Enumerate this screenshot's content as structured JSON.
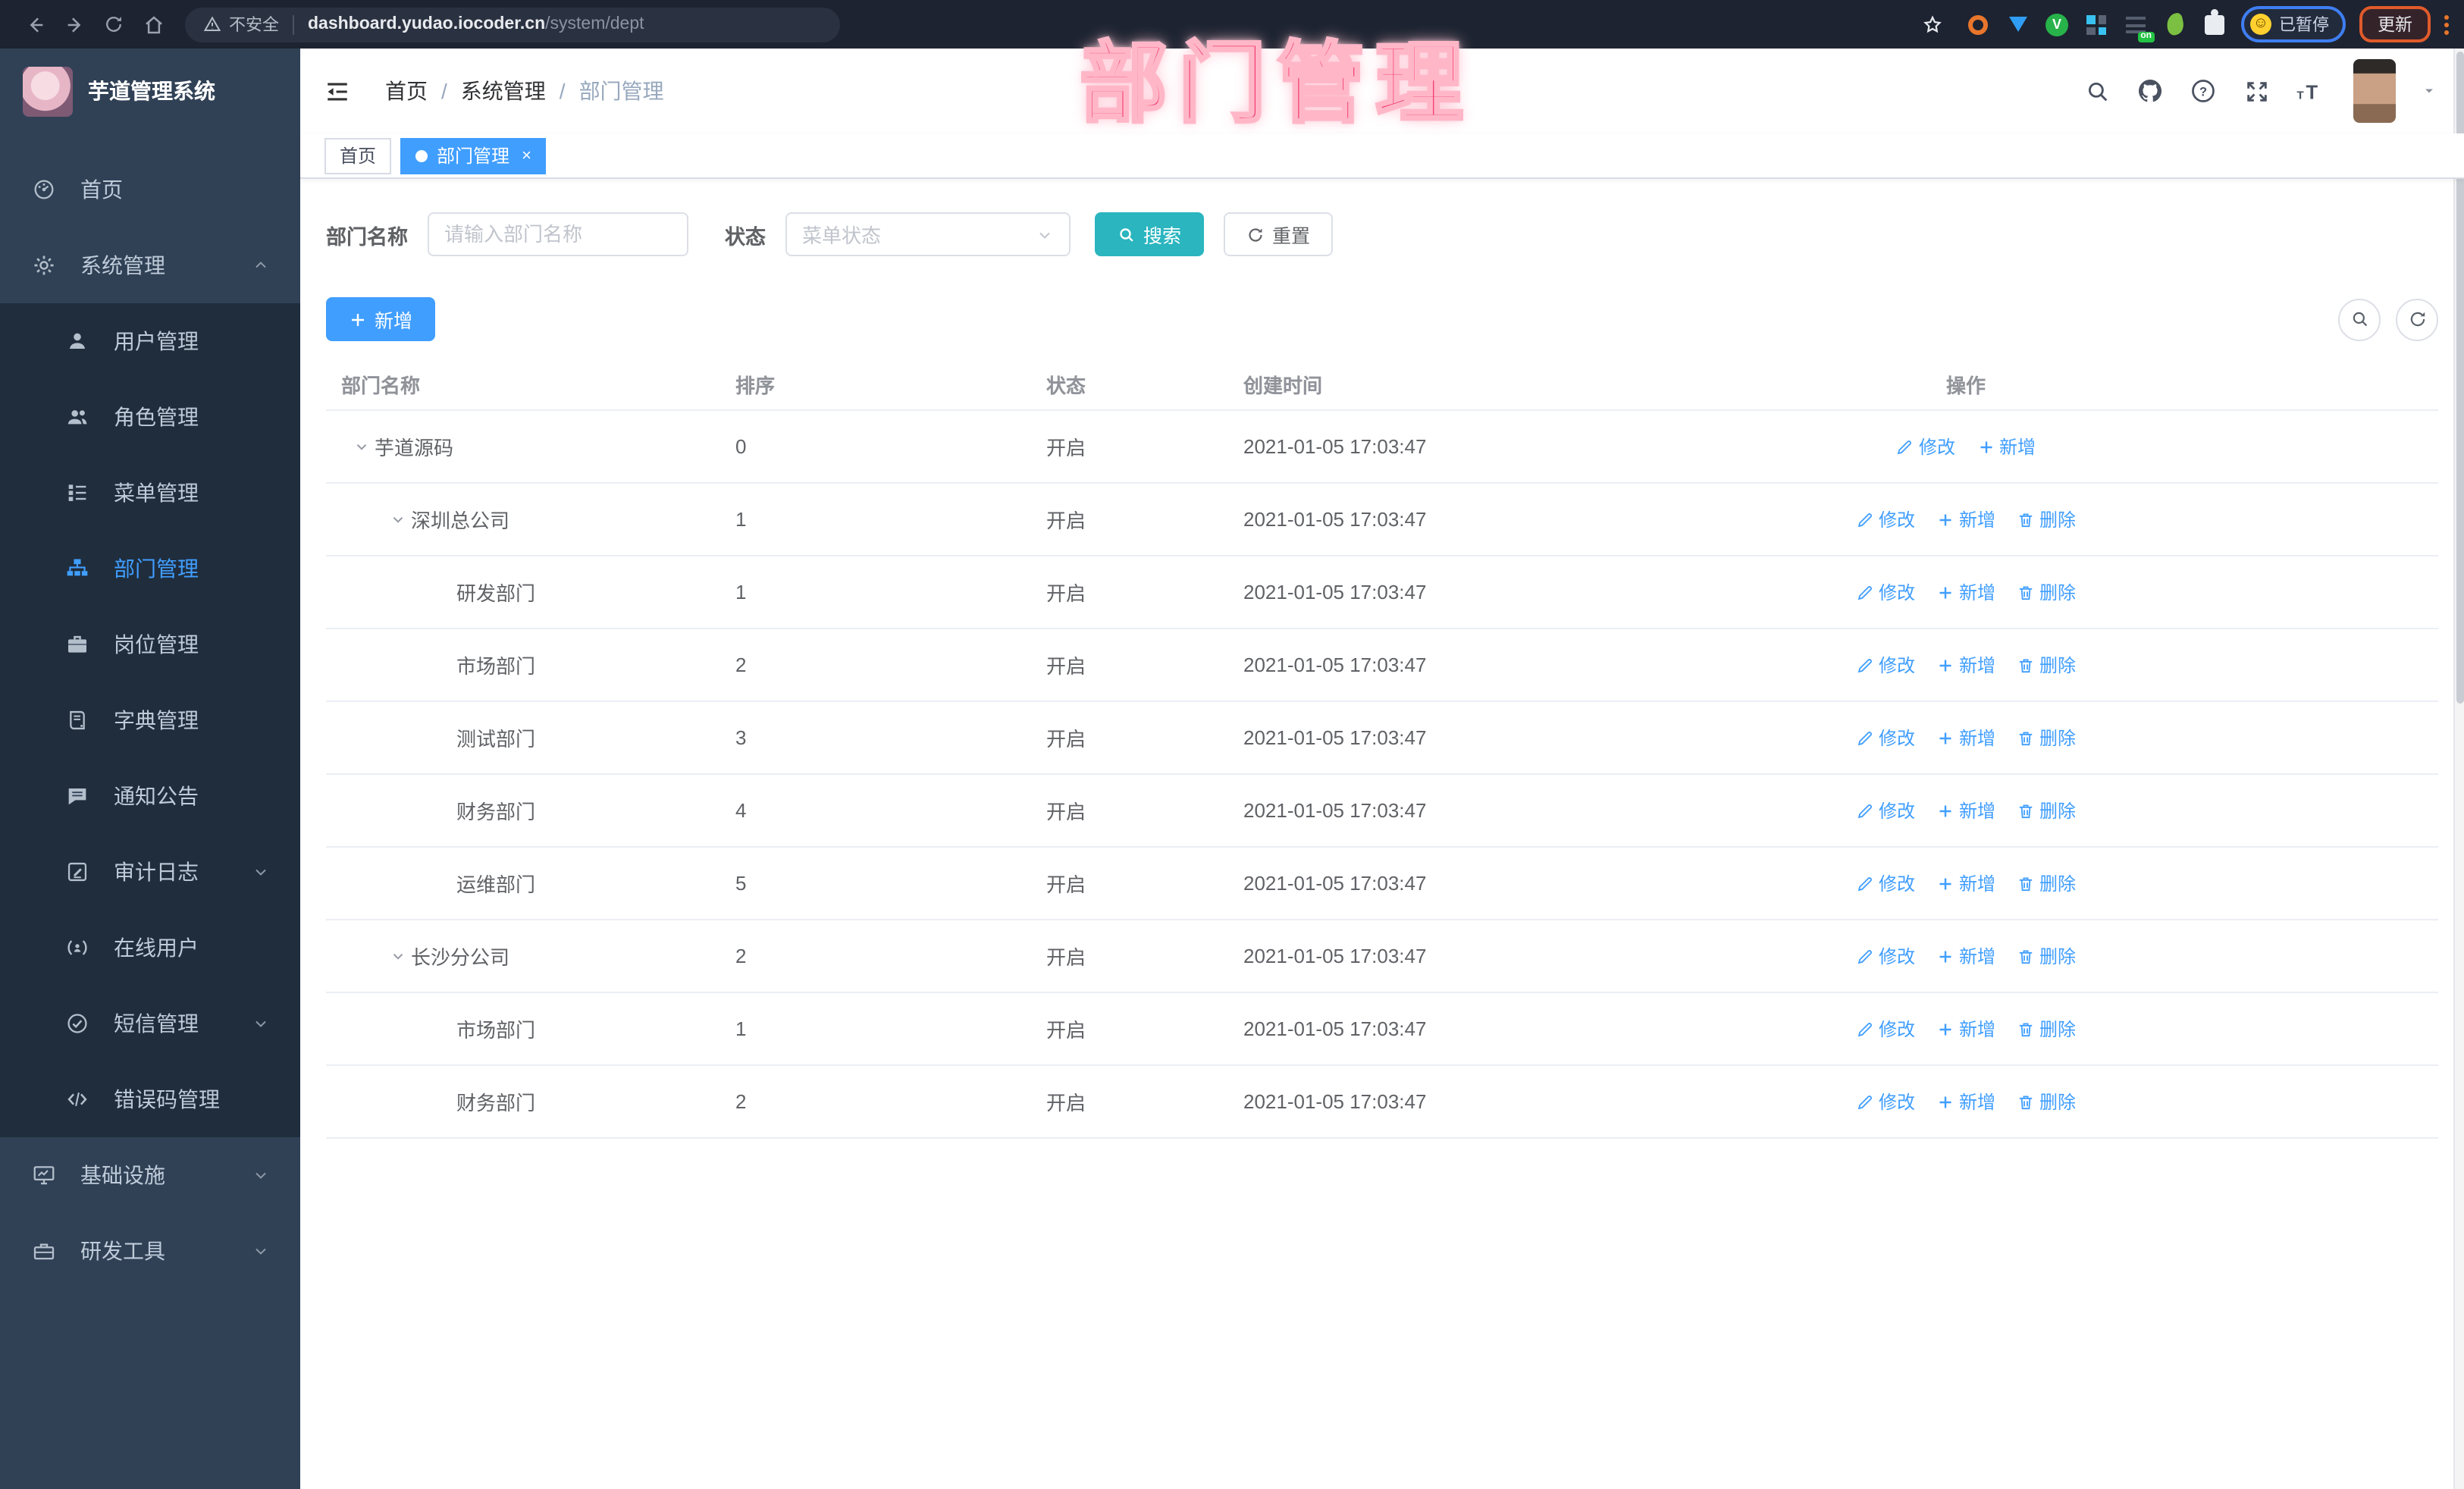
{
  "browser": {
    "security_label": "不安全",
    "url_host": "dashboard.yudao.iocoder.cn",
    "url_path": "/system/dept",
    "extension_badge": "on",
    "paused_badge": "已暂停",
    "update_button": "更新",
    "extensions": [
      "ext-orange-ring-icon",
      "ext-blue-drop-icon",
      "ext-green-check-icon",
      "ext-blue-grid-icon",
      "ext-list-on-icon",
      "ext-green-leaf-icon",
      "ext-puzzle-icon"
    ]
  },
  "overlay": {
    "title": "部门管理"
  },
  "sidebar": {
    "app_title": "芋道管理系统",
    "items": [
      {
        "label": "首页",
        "icon": "dashboard-icon",
        "sub": false,
        "arrow": null,
        "active": false
      },
      {
        "label": "系统管理",
        "icon": "gear-icon",
        "sub": false,
        "arrow": "up",
        "active": false
      },
      {
        "label": "用户管理",
        "icon": "user-icon",
        "sub": true,
        "arrow": null,
        "active": false
      },
      {
        "label": "角色管理",
        "icon": "users-icon",
        "sub": true,
        "arrow": null,
        "active": false
      },
      {
        "label": "菜单管理",
        "icon": "menu-tree-icon",
        "sub": true,
        "arrow": null,
        "active": false
      },
      {
        "label": "部门管理",
        "icon": "org-tree-icon",
        "sub": true,
        "arrow": null,
        "active": true
      },
      {
        "label": "岗位管理",
        "icon": "briefcase-icon",
        "sub": true,
        "arrow": null,
        "active": false
      },
      {
        "label": "字典管理",
        "icon": "dictionary-icon",
        "sub": true,
        "arrow": null,
        "active": false
      },
      {
        "label": "通知公告",
        "icon": "announcement-icon",
        "sub": true,
        "arrow": null,
        "active": false
      },
      {
        "label": "审计日志",
        "icon": "audit-log-icon",
        "sub": true,
        "arrow": "down",
        "active": false
      },
      {
        "label": "在线用户",
        "icon": "online-user-icon",
        "sub": true,
        "arrow": null,
        "active": false
      },
      {
        "label": "短信管理",
        "icon": "sms-icon",
        "sub": true,
        "arrow": "down",
        "active": false
      },
      {
        "label": "错误码管理",
        "icon": "error-code-icon",
        "sub": true,
        "arrow": null,
        "active": false
      },
      {
        "label": "基础设施",
        "icon": "infrastructure-icon",
        "sub": false,
        "arrow": "down",
        "active": false
      },
      {
        "label": "研发工具",
        "icon": "dev-tools-icon",
        "sub": false,
        "arrow": "down",
        "active": false
      }
    ]
  },
  "header": {
    "breadcrumb": [
      "首页",
      "系统管理",
      "部门管理"
    ],
    "separator": "/"
  },
  "tags": [
    {
      "label": "首页",
      "active": false,
      "closable": false
    },
    {
      "label": "部门管理",
      "active": true,
      "closable": true
    }
  ],
  "filter": {
    "name_label": "部门名称",
    "name_placeholder": "请输入部门名称",
    "name_value": "",
    "status_label": "状态",
    "status_placeholder": "菜单状态",
    "search_label": "搜索",
    "reset_label": "重置"
  },
  "toolbar": {
    "add_label": "新增"
  },
  "table": {
    "columns": [
      "部门名称",
      "排序",
      "状态",
      "创建时间",
      "操作"
    ],
    "rows": [
      {
        "name": "芋道源码",
        "level": 0,
        "expandable": true,
        "sort": "0",
        "status": "开启",
        "created": "2021-01-05 17:03:47",
        "actions": [
          "修改",
          "新增"
        ]
      },
      {
        "name": "深圳总公司",
        "level": 1,
        "expandable": true,
        "sort": "1",
        "status": "开启",
        "created": "2021-01-05 17:03:47",
        "actions": [
          "修改",
          "新增",
          "删除"
        ]
      },
      {
        "name": "研发部门",
        "level": 2,
        "expandable": false,
        "sort": "1",
        "status": "开启",
        "created": "2021-01-05 17:03:47",
        "actions": [
          "修改",
          "新增",
          "删除"
        ]
      },
      {
        "name": "市场部门",
        "level": 2,
        "expandable": false,
        "sort": "2",
        "status": "开启",
        "created": "2021-01-05 17:03:47",
        "actions": [
          "修改",
          "新增",
          "删除"
        ]
      },
      {
        "name": "测试部门",
        "level": 2,
        "expandable": false,
        "sort": "3",
        "status": "开启",
        "created": "2021-01-05 17:03:47",
        "actions": [
          "修改",
          "新增",
          "删除"
        ]
      },
      {
        "name": "财务部门",
        "level": 2,
        "expandable": false,
        "sort": "4",
        "status": "开启",
        "created": "2021-01-05 17:03:47",
        "actions": [
          "修改",
          "新增",
          "删除"
        ]
      },
      {
        "name": "运维部门",
        "level": 2,
        "expandable": false,
        "sort": "5",
        "status": "开启",
        "created": "2021-01-05 17:03:47",
        "actions": [
          "修改",
          "新增",
          "删除"
        ]
      },
      {
        "name": "长沙分公司",
        "level": 1,
        "expandable": true,
        "sort": "2",
        "status": "开启",
        "created": "2021-01-05 17:03:47",
        "actions": [
          "修改",
          "新增",
          "删除"
        ]
      },
      {
        "name": "市场部门",
        "level": 2,
        "expandable": false,
        "sort": "1",
        "status": "开启",
        "created": "2021-01-05 17:03:47",
        "actions": [
          "修改",
          "新增",
          "删除"
        ]
      },
      {
        "name": "财务部门",
        "level": 2,
        "expandable": false,
        "sort": "2",
        "status": "开启",
        "created": "2021-01-05 17:03:47",
        "actions": [
          "修改",
          "新增",
          "删除"
        ]
      }
    ]
  },
  "colors": {
    "primary": "#409eff",
    "search_button": "#2ab5bf",
    "sidebar_bg": "#304156",
    "submenu_bg": "#1f2d3d",
    "overlay_pink": "#f2376d",
    "browser_bar_bg": "#1d2330"
  }
}
